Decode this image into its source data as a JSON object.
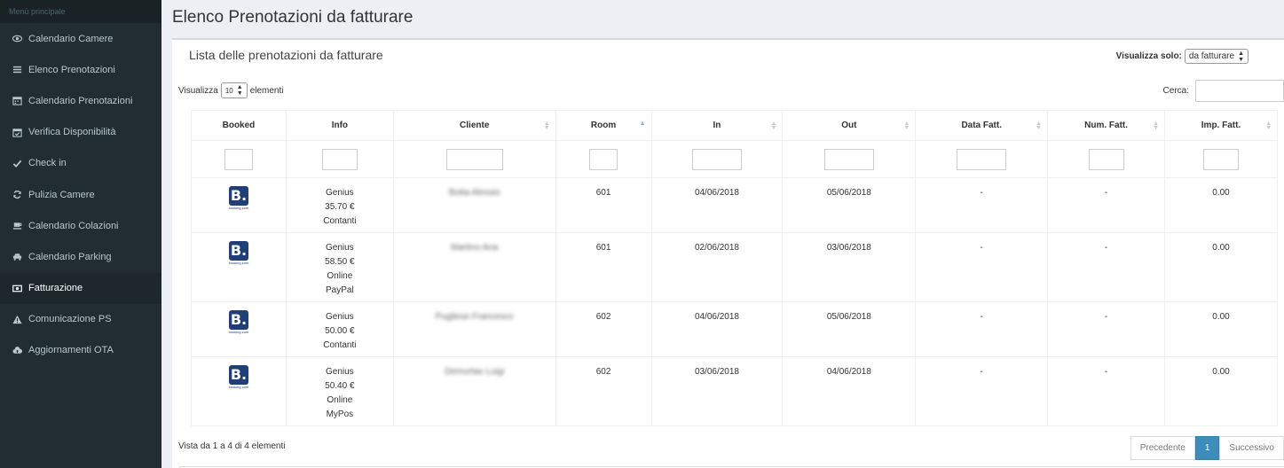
{
  "sidebar": {
    "header": "Menù principale",
    "items": [
      {
        "label": "Calendario Camere",
        "icon": "eye-icon"
      },
      {
        "label": "Elenco Prenotazioni",
        "icon": "list-icon"
      },
      {
        "label": "Calendario Prenotazioni",
        "icon": "calendar-icon"
      },
      {
        "label": "Verifica Disponibilità",
        "icon": "calendar-check-icon"
      },
      {
        "label": "Check in",
        "icon": "check-icon"
      },
      {
        "label": "Pulizia Camere",
        "icon": "refresh-icon"
      },
      {
        "label": "Calendario Colazioni",
        "icon": "coffee-icon"
      },
      {
        "label": "Calendario Parking",
        "icon": "car-icon"
      },
      {
        "label": "Fatturazione",
        "icon": "money-icon",
        "active": true
      },
      {
        "label": "Comunicazione PS",
        "icon": "warning-icon"
      },
      {
        "label": "Aggiornamenti OTA",
        "icon": "cloud-upload-icon"
      }
    ]
  },
  "page": {
    "title": "Elenco Prenotazioni da fatturare",
    "box_title": "Lista delle prenotazioni da fatturare",
    "filter_label": "Visualizza solo:",
    "filter_value": "da fatturare",
    "length_prefix": "Visualizza",
    "length_value": "10",
    "length_suffix": "elementi",
    "search_label": "Cerca:",
    "info": "Vista da 1 a 4 di 4 elementi"
  },
  "table": {
    "columns": [
      "Booked",
      "Info",
      "Cliente",
      "Room",
      "In",
      "Out",
      "Data Fatt.",
      "Num. Fatt.",
      "Imp. Fatt."
    ],
    "rows": [
      {
        "booked": "booking.com",
        "info": [
          "Genius",
          "35.70 €",
          "Contanti"
        ],
        "cliente": "Botta Alessio",
        "room": "601",
        "in": "04/06/2018",
        "out": "05/06/2018",
        "data_fatt": "-",
        "num_fatt": "-",
        "imp_fatt": "0.00"
      },
      {
        "booked": "booking.com",
        "info": [
          "Genius",
          "58.50 €",
          "Online",
          "PayPal"
        ],
        "cliente": "Martino Ana",
        "room": "601",
        "in": "02/06/2018",
        "out": "03/06/2018",
        "data_fatt": "-",
        "num_fatt": "-",
        "imp_fatt": "0.00"
      },
      {
        "booked": "booking.com",
        "info": [
          "Genius",
          "50.00 €",
          "Contanti"
        ],
        "cliente": "Pugliese Francesco",
        "room": "602",
        "in": "04/06/2018",
        "out": "05/06/2018",
        "data_fatt": "-",
        "num_fatt": "-",
        "imp_fatt": "0.00"
      },
      {
        "booked": "booking.com",
        "info": [
          "Genius",
          "50.40 €",
          "Online",
          "MyPos"
        ],
        "cliente": "Demurtas Luigi",
        "room": "602",
        "in": "03/06/2018",
        "out": "04/06/2018",
        "data_fatt": "-",
        "num_fatt": "-",
        "imp_fatt": "0.00"
      }
    ]
  },
  "pagination": {
    "prev": "Precedente",
    "current": "1",
    "next": "Successivo"
  },
  "colors": {
    "sidebar_bg": "#222d32",
    "accent": "#3c8dbc",
    "booking_blue": "#1f3f78"
  }
}
